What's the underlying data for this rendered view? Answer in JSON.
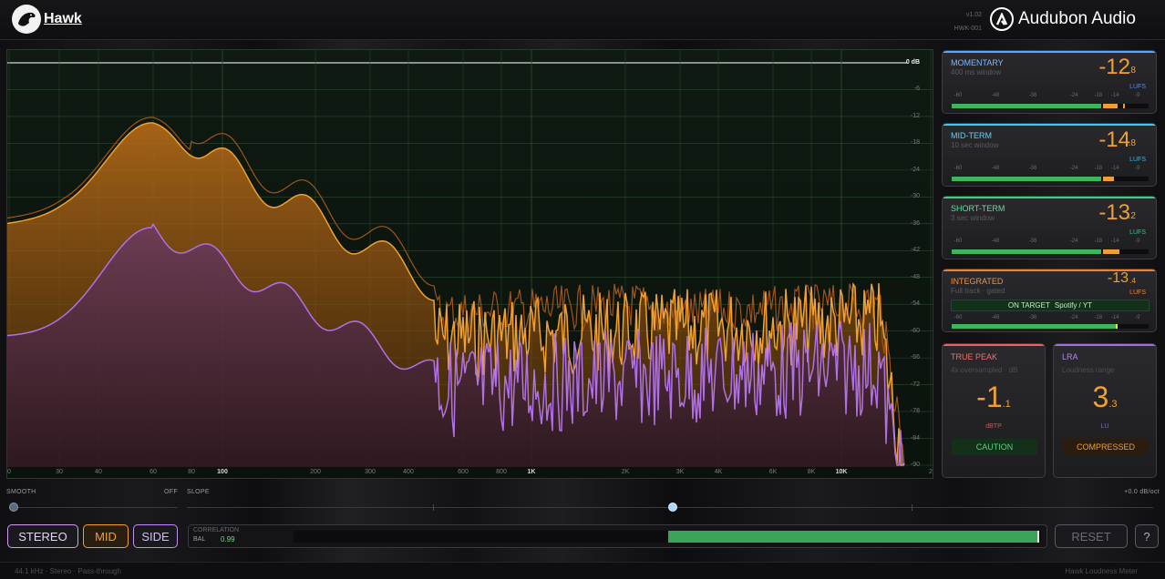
{
  "header": {
    "app_name": "Hawk",
    "version": "v1.02",
    "build": "HWK-001",
    "brand": "Audubon Audio",
    "logo_icon": "hawk-icon",
    "brand_icon": "audubon-a-icon"
  },
  "spectrum": {
    "zero_db_label": "0 dB",
    "db_labels": [
      "-6",
      "-12",
      "-18",
      "-24",
      "-30",
      "-36",
      "-42",
      "-48",
      "-54",
      "-60",
      "-66",
      "-72",
      "-78",
      "-84",
      "-90"
    ],
    "freq_labels": [
      "0",
      "30",
      "40",
      "60",
      "80",
      "100",
      "200",
      "300",
      "400",
      "600",
      "800",
      "1K",
      "2K",
      "3K",
      "4K",
      "6K",
      "8K",
      "10K",
      "2"
    ],
    "colors": {
      "mid": "#f0a030",
      "side": "#b070e8",
      "grid": "#2b4a30"
    }
  },
  "controls": {
    "smooth_label": "SMOOTH",
    "smooth_off": "OFF",
    "slope_label": "SLOPE",
    "slope_value": "+0.0 dB/oct",
    "modes": {
      "stereo": "STEREO",
      "mid": "MID",
      "side": "SIDE"
    },
    "correlation_title": "CORRELATION",
    "bal_label": "BAL",
    "correlation_value": "0.99",
    "correlation_fill": 0.5,
    "reset": "RESET",
    "help": "?"
  },
  "footer": {
    "left": "44.1 kHz  ·  Stereo  ·  Pass-through",
    "right": "Hawk Loudness Meter"
  },
  "meters": {
    "scale": [
      "-60",
      "-48",
      "-36",
      "-24",
      "-18",
      "-14",
      "-9"
    ],
    "momentary": {
      "title": "MOMENTARY",
      "sub": "400 ms window",
      "value": "-12",
      "decimal": ".8",
      "unit": "LUFS",
      "level": 0.82,
      "color": "#5aa8ff"
    },
    "midterm": {
      "title": "MID-TERM",
      "sub": "10 sec window",
      "value": "-14",
      "decimal": ".8",
      "unit": "LUFS",
      "level": 0.78,
      "color": "#38d0f0"
    },
    "shortterm": {
      "title": "SHORT-TERM",
      "sub": "3 sec window",
      "value": "-13",
      "decimal": ".2",
      "unit": "LUFS",
      "level": 0.8,
      "color": "#40d080"
    },
    "integrated": {
      "title": "INTEGRATED",
      "sub": "Full track · gated",
      "value": "-13",
      "decimal": ".4",
      "unit": "LUFS",
      "target_status": "ON TARGET",
      "target_name": "Spotify / YT",
      "level": 0.84,
      "color": "#f08030"
    },
    "truepeak": {
      "title": "TRUE PEAK",
      "sub": "4x oversampled · dB",
      "value": "-1",
      "decimal": ".1",
      "unit": "dBTP",
      "status": "CAUTION",
      "color": "#f06060"
    },
    "lra": {
      "title": "LRA",
      "sub": "Loudness range",
      "value": "3",
      "decimal": ".3",
      "unit": "LU",
      "status": "COMPRESSED",
      "color": "#a070e0"
    }
  }
}
